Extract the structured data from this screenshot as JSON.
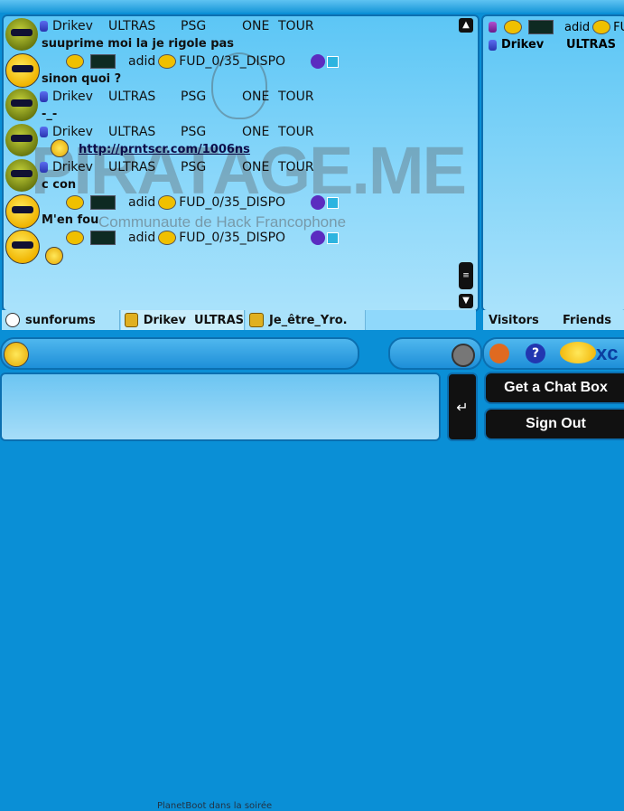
{
  "chat": {
    "messages": [
      {
        "type": "header",
        "user": "Drikev",
        "tags": [
          "ULTRAS",
          "PSG",
          "ONE",
          "TOUR"
        ],
        "text": "suuprime moi la je rigole pas"
      },
      {
        "type": "header2",
        "user": "adid",
        "status": "FUD_0/35_DISPO",
        "text": "sinon quoi ?"
      },
      {
        "type": "header",
        "user": "Drikev",
        "tags": [
          "ULTRAS",
          "PSG",
          "ONE",
          "TOUR"
        ],
        "text": "-_-"
      },
      {
        "type": "header",
        "user": "Drikev",
        "tags": [
          "ULTRAS",
          "PSG",
          "ONE",
          "TOUR"
        ],
        "text": "http://prntscr.com/1006ns"
      },
      {
        "type": "header",
        "user": "Drikev",
        "tags": [
          "ULTRAS",
          "PSG",
          "ONE",
          "TOUR"
        ],
        "text": "c con"
      },
      {
        "type": "header2",
        "user": "adid",
        "status": "FUD_0/35_DISPO",
        "text": "M'en fou"
      },
      {
        "type": "header2",
        "user": "adid",
        "status": "FUD_0/35_DISPO",
        "text": ""
      }
    ]
  },
  "watermark": {
    "title": "PIRATAGE.ME",
    "subtitle": "Communaute de Hack Francophone"
  },
  "userlist": {
    "row1_name": "adid",
    "row1_status": "FU",
    "row2_name": "Drikev",
    "row2_tag": "ULTRAS"
  },
  "tabs": [
    {
      "label": "sunforums"
    },
    {
      "label": "Drikev  ULTRAS"
    },
    {
      "label": "Je_être_Yro."
    }
  ],
  "right_tabs": {
    "visitors": "Visitors",
    "friends": "Friends"
  },
  "logo_text": "xc",
  "composer": {
    "value": "",
    "placeholder": "",
    "status_text": "PlanetBoot dans la soirée",
    "send_label": "↵"
  },
  "buttons": {
    "get_chat_box": "Get a Chat Box",
    "sign_out": "Sign Out"
  },
  "scrollbar": {
    "up": "▲",
    "down": "▼",
    "thumb": "≡"
  }
}
